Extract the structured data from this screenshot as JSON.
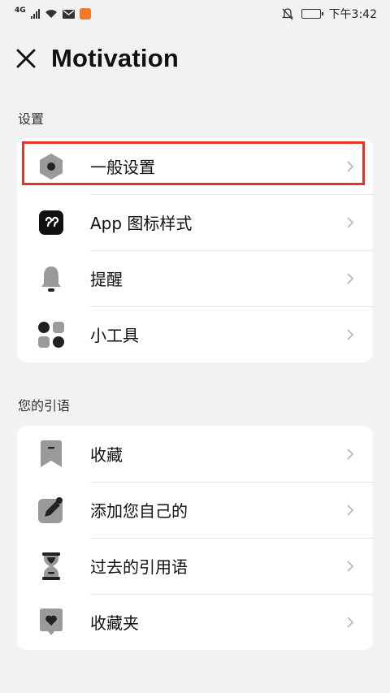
{
  "status_bar": {
    "network": "4G",
    "time": "下午3:42"
  },
  "header": {
    "title": "Motivation"
  },
  "settings_section": {
    "label": "设置",
    "items": [
      {
        "label": "一般设置",
        "icon": "hexagon-settings-icon"
      },
      {
        "label": "App 图标样式",
        "icon": "quote-app-icon"
      },
      {
        "label": "提醒",
        "icon": "bell-icon"
      },
      {
        "label": "小工具",
        "icon": "widgets-icon"
      }
    ]
  },
  "quotes_section": {
    "label": "您的引语",
    "items": [
      {
        "label": "收藏",
        "icon": "bookmark-icon"
      },
      {
        "label": "添加您自己的",
        "icon": "edit-pencil-icon"
      },
      {
        "label": "过去的引用语",
        "icon": "hourglass-icon"
      },
      {
        "label": "收藏夹",
        "icon": "heart-collection-icon"
      }
    ]
  },
  "colors": {
    "background": "#f2f2f2",
    "card": "#ffffff",
    "highlight": "#e53325",
    "icon_gray": "#9a9a9a",
    "icon_dark": "#222222"
  }
}
